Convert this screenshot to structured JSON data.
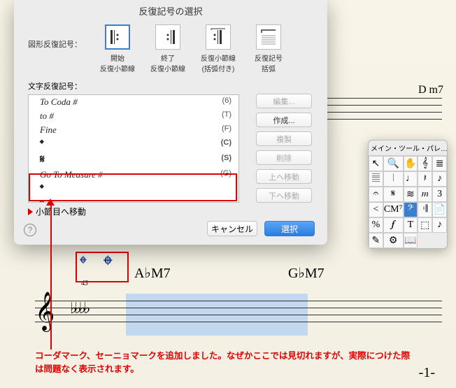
{
  "dialog": {
    "title": "反復記号の選択",
    "graphic_label": "図形反復記号：",
    "graphic_items": [
      {
        "label": "開始\n反復小節線"
      },
      {
        "label": "終了\n反復小節線"
      },
      {
        "label": "反復小節線\n(括弧付き)"
      },
      {
        "label": "反復記号\n括弧"
      }
    ],
    "text_label": "文字反復記号：",
    "list": [
      {
        "text": "To Coda #",
        "key": "(6)"
      },
      {
        "text": "to #",
        "key": "(T)"
      },
      {
        "text": "Fine",
        "key": "(F)"
      },
      {
        "text": "𝄌",
        "key": "(C)",
        "symbol": true
      },
      {
        "text": "𝄋",
        "key": "(S)",
        "symbol": true
      },
      {
        "text": "Go To Measure #",
        "key": "(G)"
      },
      {
        "text": "𝄌",
        "key": "",
        "symbol": true
      },
      {
        "text": "𝄋",
        "key": "",
        "symbol": true
      }
    ],
    "move_label": "小節目へ移動",
    "side_buttons": {
      "edit": "編集...",
      "create": "作成...",
      "dup": "複製",
      "del": "削除",
      "up": "上へ移動",
      "down": "下へ移動"
    },
    "cancel": "キャンセル",
    "select": "選択",
    "help": "?"
  },
  "palette": {
    "title": "メイン・ツール・パレ…",
    "cells": [
      "↖",
      "🔍",
      "✋",
      "𝄞",
      "≣",
      "𝄚",
      "𝄀",
      "♩",
      "𝄽",
      "♪",
      "𝄐",
      "𝄋",
      "≋",
      "𝆐",
      "3",
      "<",
      "CM⁷",
      "𝄢",
      "𝄇",
      "📄",
      "%",
      "𝆑",
      "T",
      "⬚",
      "♪",
      "✎",
      "⚙",
      "📖"
    ]
  },
  "score": {
    "chord1": "D m7",
    "chord2": "A♭M7",
    "chord3": "G♭M7",
    "measure": "43",
    "coda1": "𝄌",
    "coda2": "𝄌",
    "page": "-1-"
  },
  "annotation": {
    "text": "コーダマーク、セーニョマークを追加しました。なぜかここでは見切れますが、実際につけた際は問題なく表示されます。"
  },
  "palette_selected_index": 17
}
